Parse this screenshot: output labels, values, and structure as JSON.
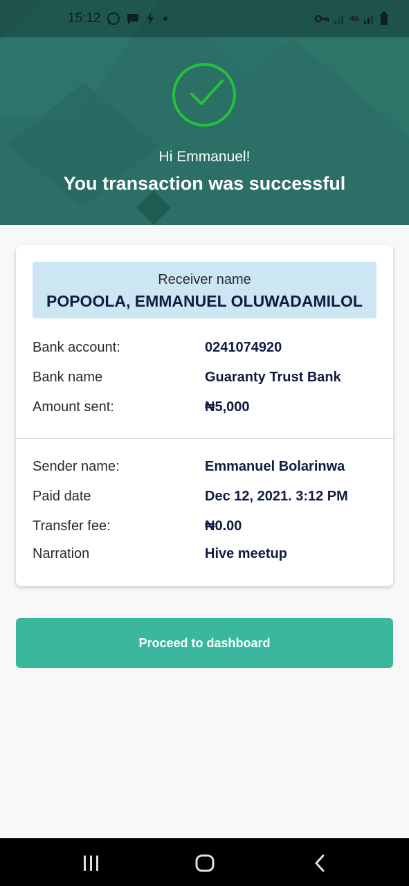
{
  "status_bar": {
    "time": "15:12",
    "network": "4G"
  },
  "header": {
    "greeting": "Hi Emmanuel!",
    "title": "You transaction was successful"
  },
  "receiver": {
    "label": "Receiver name",
    "name": "POPOOLA, EMMANUEL OLUWADAMILOL"
  },
  "details": [
    {
      "label": "Bank account:",
      "value": "0241074920"
    },
    {
      "label": "Bank name",
      "value": "Guaranty Trust Bank"
    },
    {
      "label": "Amount sent:",
      "value": "₦5,000"
    }
  ],
  "sender_details": [
    {
      "label": "Sender name:",
      "value": "Emmanuel Bolarinwa"
    },
    {
      "label": "Paid date",
      "value": "Dec 12, 2021. 3:12 PM"
    },
    {
      "label": "Transfer fee:",
      "value": "₦0.00"
    },
    {
      "label": "Narration",
      "value": "Hive meetup"
    }
  ],
  "actions": {
    "proceed_label": "Proceed to dashboard"
  },
  "colors": {
    "header_bg": "#2b6f66",
    "success_green": "#22c23a",
    "button": "#3ab79d",
    "receiver_box": "#cde6f4",
    "value_text": "#0f1c40"
  },
  "icons": {
    "success": "check-circle-icon",
    "nav_recents": "recents-icon",
    "nav_home": "home-icon",
    "nav_back": "back-icon"
  }
}
